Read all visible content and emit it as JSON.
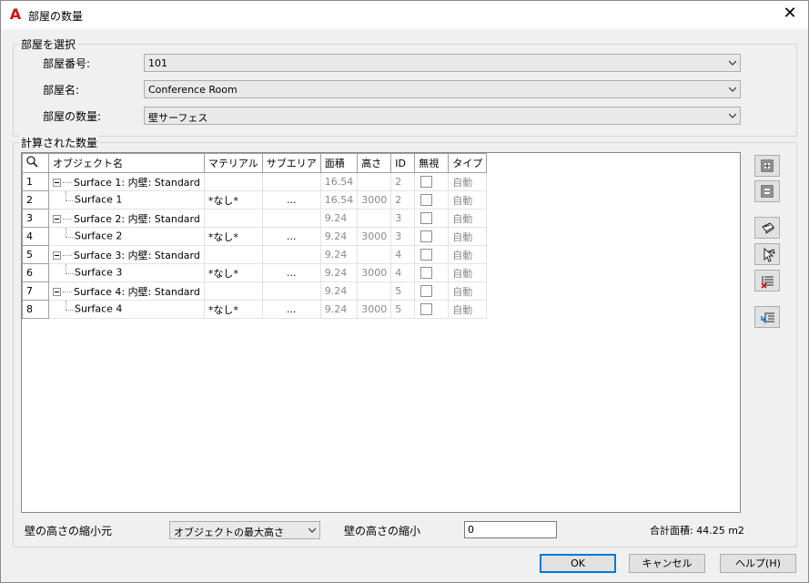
{
  "window": {
    "title": "部屋の数量",
    "app_icon": "A"
  },
  "select_room": {
    "group_label": "部屋を選択",
    "room_number_label": "部屋番号:",
    "room_number_value": "101",
    "room_name_label": "部屋名:",
    "room_name_value": "Conference Room",
    "room_quantity_label": "部屋の数量:",
    "room_quantity_value": "壁サーフェス"
  },
  "calculated": {
    "group_label": "計算された数量",
    "columns": [
      "オブジェクト名",
      "マテリアル",
      "サブエリア",
      "面積",
      "高さ",
      "ID",
      "無視",
      "タイプ"
    ],
    "rows": [
      {
        "n": "1",
        "name": "Surface 1: 内壁: Standard",
        "material": "",
        "subarea": "",
        "area": "16.54",
        "height": "",
        "id": "2",
        "type": "自動",
        "level": 0
      },
      {
        "n": "2",
        "name": "Surface 1",
        "material": "*なし*",
        "subarea": "...",
        "area": "16.54",
        "height": "3000",
        "id": "2",
        "type": "自動",
        "level": 1
      },
      {
        "n": "3",
        "name": "Surface 2: 内壁: Standard",
        "material": "",
        "subarea": "",
        "area": "9.24",
        "height": "",
        "id": "3",
        "type": "自動",
        "level": 0
      },
      {
        "n": "4",
        "name": "Surface 2",
        "material": "*なし*",
        "subarea": "...",
        "area": "9.24",
        "height": "3000",
        "id": "3",
        "type": "自動",
        "level": 1
      },
      {
        "n": "5",
        "name": "Surface 3: 内壁: Standard",
        "material": "",
        "subarea": "",
        "area": "9.24",
        "height": "",
        "id": "4",
        "type": "自動",
        "level": 0
      },
      {
        "n": "6",
        "name": "Surface 3",
        "material": "*なし*",
        "subarea": "...",
        "area": "9.24",
        "height": "3000",
        "id": "4",
        "type": "自動",
        "level": 1
      },
      {
        "n": "7",
        "name": "Surface 4: 内壁: Standard",
        "material": "",
        "subarea": "",
        "area": "9.24",
        "height": "",
        "id": "5",
        "type": "自動",
        "level": 0
      },
      {
        "n": "8",
        "name": "Surface 4",
        "material": "*なし*",
        "subarea": "...",
        "area": "9.24",
        "height": "3000",
        "id": "5",
        "type": "自動",
        "level": 1
      }
    ]
  },
  "bottom": {
    "wall_height_source_label": "壁の高さの縮小元",
    "wall_height_source_value": "オブジェクトの最大高さ",
    "wall_height_reduction_label": "壁の高さの縮小",
    "wall_height_reduction_value": "0",
    "total_area_label": "合計面積: 44.25 m2"
  },
  "buttons": {
    "ok": "OK",
    "cancel": "キャンセル",
    "help": "ヘルプ(H)"
  },
  "colors": {
    "accent": "#0078d7",
    "app_icon": "#d51010"
  }
}
